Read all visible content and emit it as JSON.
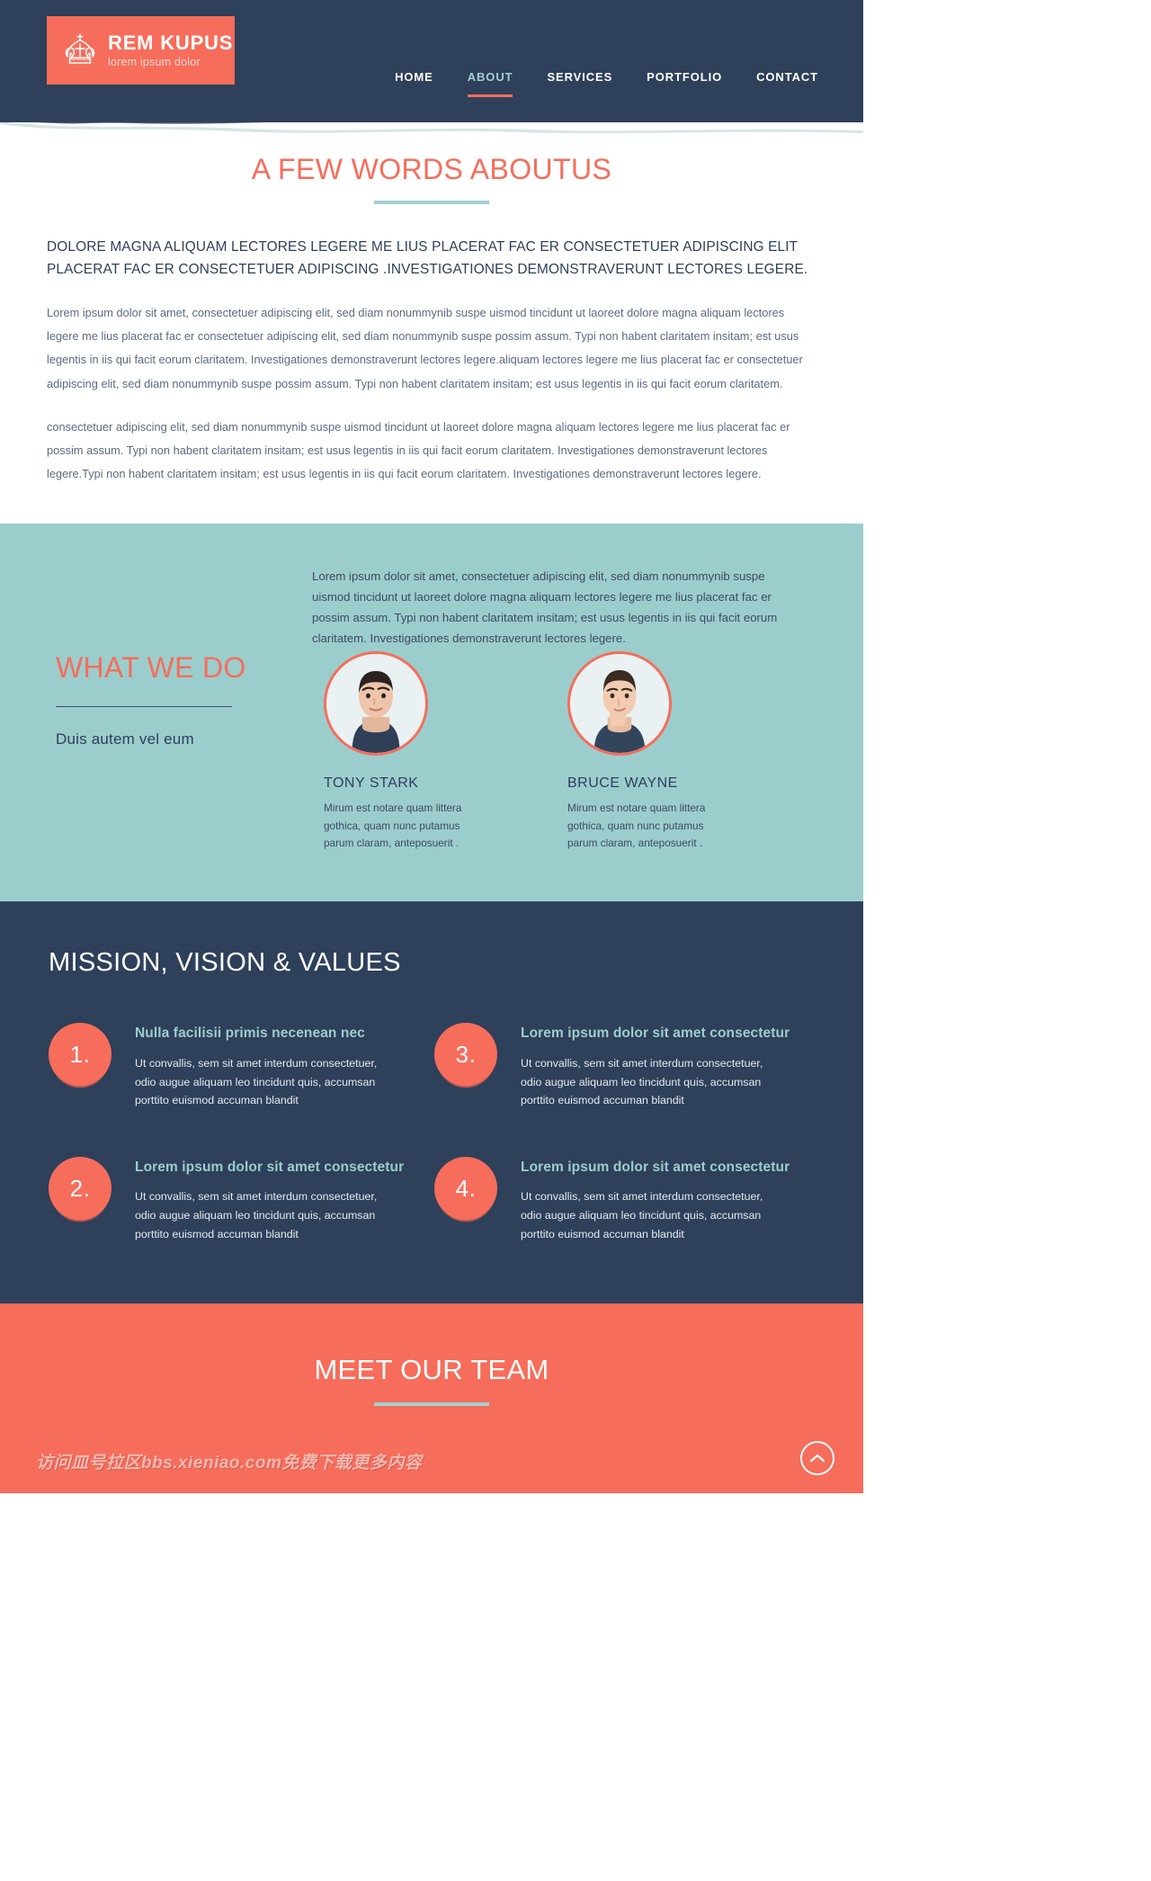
{
  "header": {
    "logo": {
      "icon": "crown-icon",
      "title": "REM KUPUS",
      "subtitle": "lorem ipsum dolor",
      "background_color": "#f66d5b"
    },
    "background_color": "#2e405a",
    "nav": [
      {
        "label": "HOME",
        "active": false
      },
      {
        "label": "ABOUT",
        "active": true
      },
      {
        "label": "SERVICES",
        "active": false
      },
      {
        "label": "PORTFOLIO",
        "active": false
      },
      {
        "label": "CONTACT",
        "active": false
      }
    ],
    "active_color": "#a5cfd2"
  },
  "about": {
    "title": "A FEW WORDS ABOUTUS",
    "title_color": "#f66d5b",
    "rule_color": "#a5cfd2",
    "lead": "DOLORE MAGNA ALIQUAM LECTORES LEGERE ME LIUS PLACERAT FAC ER CONSECTETUER ADIPISCING ELIT PLACERAT FAC ER CONSECTETUER ADIPISCING .INVESTIGATIONES DEMONSTRAVERUNT LECTORES LEGERE.",
    "paragraph_1": "Lorem ipsum dolor sit amet, consectetuer adipiscing elit, sed diam nonummynib suspe uismod tincidunt ut laoreet dolore magna aliquam lectores legere me lius placerat fac er consectetuer adipiscing elit, sed diam nonummynib suspe possim assum. Typi non habent claritatem insitam; est usus legentis in iis qui facit eorum claritatem. Investigationes demonstraverunt lectores legere.aliquam lectores legere me lius placerat fac er consectetuer adipiscing elit, sed diam nonummynib suspe possim assum. Typi non habent claritatem insitam; est usus legentis in iis qui facit eorum claritatem.",
    "paragraph_2": "consectetuer adipiscing elit, sed diam nonummynib suspe uismod tincidunt ut laoreet dolore magna aliquam lectores legere me lius placerat fac er possim assum. Typi non habent claritatem insitam; est usus legentis in iis qui facit eorum claritatem. Investigationes demonstraverunt lectores legere.Typi non habent claritatem insitam; est usus legentis in iis qui facit eorum claritatem. Investigationes demonstraverunt lectores legere."
  },
  "what_we_do": {
    "background_color": "#9ccdcd",
    "title": "WHAT WE DO",
    "title_color": "#f66d5b",
    "subtitle": "Duis autem vel eum",
    "intro": "Lorem ipsum dolor sit amet, consectetuer adipiscing elit, sed diam nonummynib suspe uismod tincidunt ut laoreet dolore magna aliquam lectores legere me lius placerat fac er possim assum. Typi non habent claritatem insitam; est usus legentis in iis qui facit eorum claritatem. Investigationes demonstraverunt lectores legere.",
    "members": [
      {
        "name": "TONY STARK",
        "description": "Mirum est notare quam littera gothica, quam nunc putamus parum claram, anteposuerit ."
      },
      {
        "name": "BRUCE WAYNE",
        "description": "Mirum est notare quam littera gothica, quam nunc putamus parum claram, anteposuerit ."
      }
    ]
  },
  "mission": {
    "background_color": "#2e405a",
    "title": "MISSION, VISION & VALUES",
    "heading_color": "#9ccdcd",
    "circle_color": "#f66d5b",
    "items": [
      {
        "number": "1.",
        "heading": "Nulla facilisii primis necenean nec",
        "text": "Ut convallis, sem sit amet interdum consectetuer, odio augue aliquam leo tincidunt quis, accumsan porttito euismod accuman blandit"
      },
      {
        "number": "3.",
        "heading": "Lorem ipsum dolor sit amet consectetur",
        "text": "Ut convallis, sem sit amet interdum consectetuer, odio augue aliquam leo tincidunt quis, accumsan porttito euismod accuman blandit"
      },
      {
        "number": "2.",
        "heading": "Lorem ipsum dolor sit amet consectetur",
        "text": "Ut convallis, sem sit amet interdum consectetuer, odio augue aliquam leo tincidunt quis, accumsan porttito euismod accuman blandit"
      },
      {
        "number": "4.",
        "heading": "Lorem ipsum dolor sit amet consectetur",
        "text": "Ut convallis, sem sit amet interdum consectetuer, odio augue aliquam leo tincidunt quis, accumsan porttito euismod accuman blandit"
      }
    ]
  },
  "team": {
    "background_color": "#f66d5b",
    "title": "MEET OUR TEAM",
    "rule_color": "#a5cfd2",
    "watermark": "访问皿号拉区bbs.xieniao.com免费下载更多内容",
    "to_top_icon": "chevron-up-icon"
  }
}
